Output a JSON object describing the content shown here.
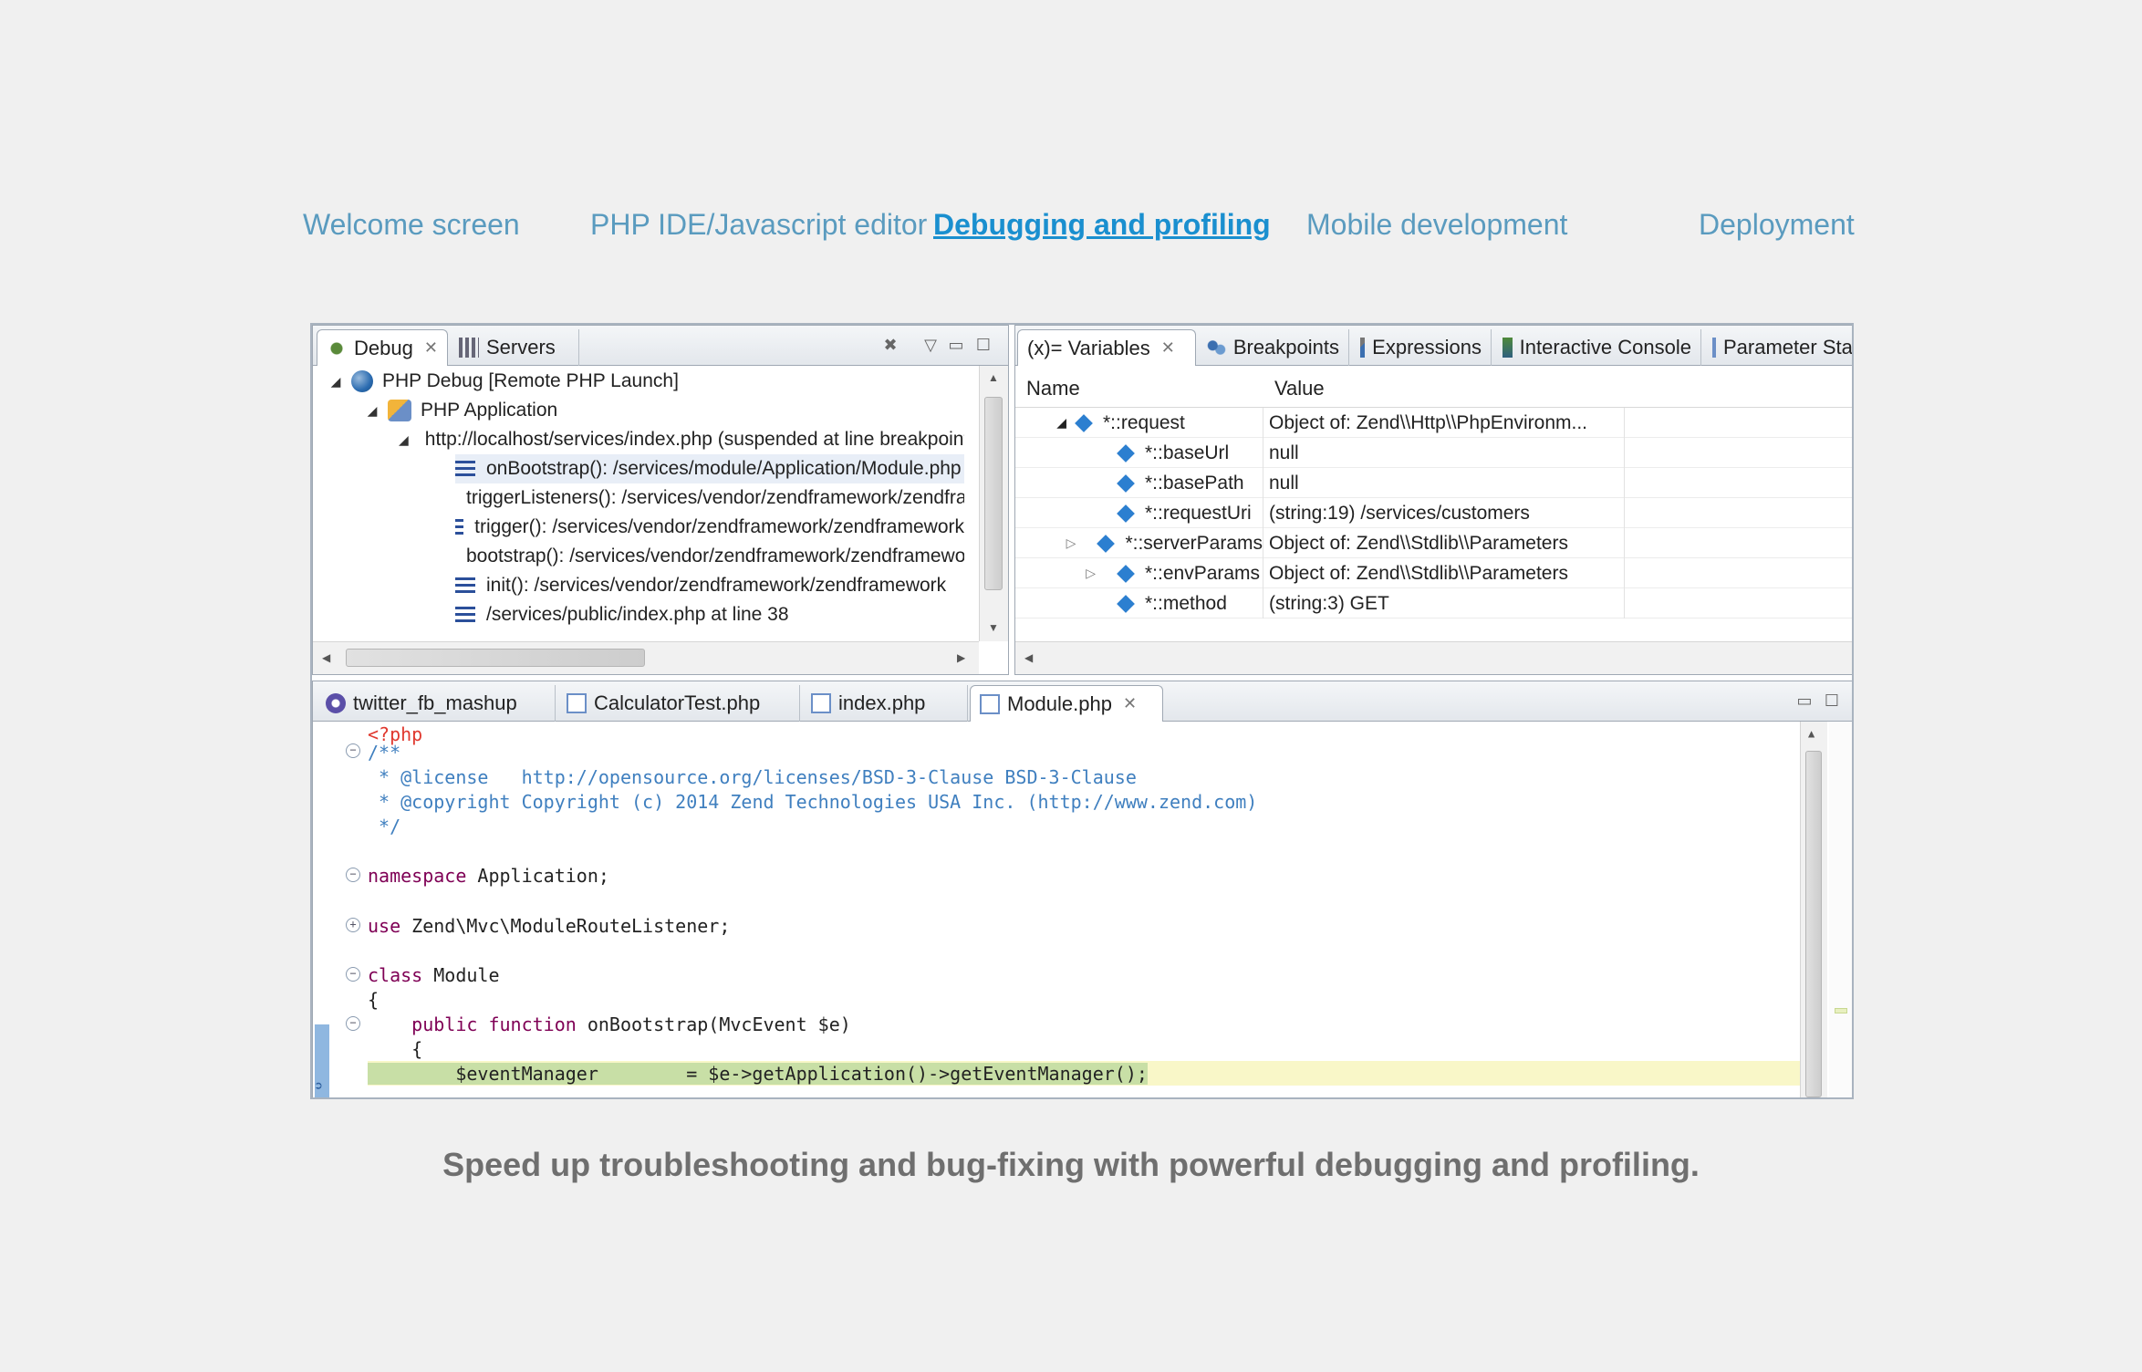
{
  "nav": [
    {
      "label": "Welcome screen"
    },
    {
      "label": "PHP IDE/Javascript editor"
    },
    {
      "label": "Debugging and profiling",
      "active": true
    },
    {
      "label": "Mobile development"
    },
    {
      "label": "Deployment"
    }
  ],
  "debug_pane": {
    "tabs": [
      {
        "label": "Debug"
      },
      {
        "label": "Servers"
      }
    ],
    "tree": [
      {
        "label": "PHP Debug [Remote PHP Launch]"
      },
      {
        "label": "PHP Application"
      },
      {
        "label": "http://localhost/services/index.php (suspended at line breakpoint)"
      },
      {
        "label": "onBootstrap(): /services/module/Application/Module.php"
      },
      {
        "label": "triggerListeners(): /services/vendor/zendframework/zendframework"
      },
      {
        "label": "trigger(): /services/vendor/zendframework/zendframework"
      },
      {
        "label": "bootstrap(): /services/vendor/zendframework/zendframework"
      },
      {
        "label": "init(): /services/vendor/zendframework/zendframework"
      },
      {
        "label": "/services/public/index.php at line 38"
      }
    ]
  },
  "variables_pane": {
    "tabs": [
      {
        "label": "(x)= Variables"
      },
      {
        "label": "Breakpoints"
      },
      {
        "label": "Expressions"
      },
      {
        "label": "Interactive Console"
      },
      {
        "label": "Parameter Stack"
      }
    ],
    "columns": {
      "name": "Name",
      "value": "Value"
    },
    "rows": [
      {
        "name": "*::request",
        "value": "Object of: Zend\\\\Http\\\\PhpEnvironm..."
      },
      {
        "name": "*::baseUrl",
        "value": "null"
      },
      {
        "name": "*::basePath",
        "value": "null"
      },
      {
        "name": "*::requestUri",
        "value": "(string:19) /services/customers"
      },
      {
        "name": "*::serverParams",
        "value": "Object of: Zend\\\\Stdlib\\\\Parameters"
      },
      {
        "name": "*::envParams",
        "value": "Object of: Zend\\\\Stdlib\\\\Parameters"
      },
      {
        "name": "*::method",
        "value": "(string:3) GET"
      }
    ]
  },
  "editor": {
    "tabs": [
      {
        "label": "twitter_fb_mashup"
      },
      {
        "label": "CalculatorTest.php"
      },
      {
        "label": "index.php"
      },
      {
        "label": "Module.php"
      }
    ],
    "code": {
      "l1": "<?php",
      "l2": "/**",
      "l3a": " * @license   ",
      "l3b": "http://opensource.org/licenses/BSD-3-Clause BSD-3-Clause",
      "l4a": " * @copyright ",
      "l4b": "Copyright (c) 2014 Zend Technologies USA Inc. (http://www.zend.com)",
      "l5": " */",
      "l7a": "namespace",
      "l7b": " Application;",
      "l9a": "use",
      "l9b": " Zend\\Mvc\\ModuleRouteListener;",
      "l11a": "class",
      "l11b": " Module",
      "l12": "{",
      "l13a": "    public function",
      "l13b": " onBootstrap(MvcEvent $e)",
      "l14": "    {",
      "l15": "        $eventManager        = $e->getApplication()->getEventManager();"
    }
  },
  "caption": "Speed up troubleshooting and bug-fixing with powerful debugging and profiling."
}
